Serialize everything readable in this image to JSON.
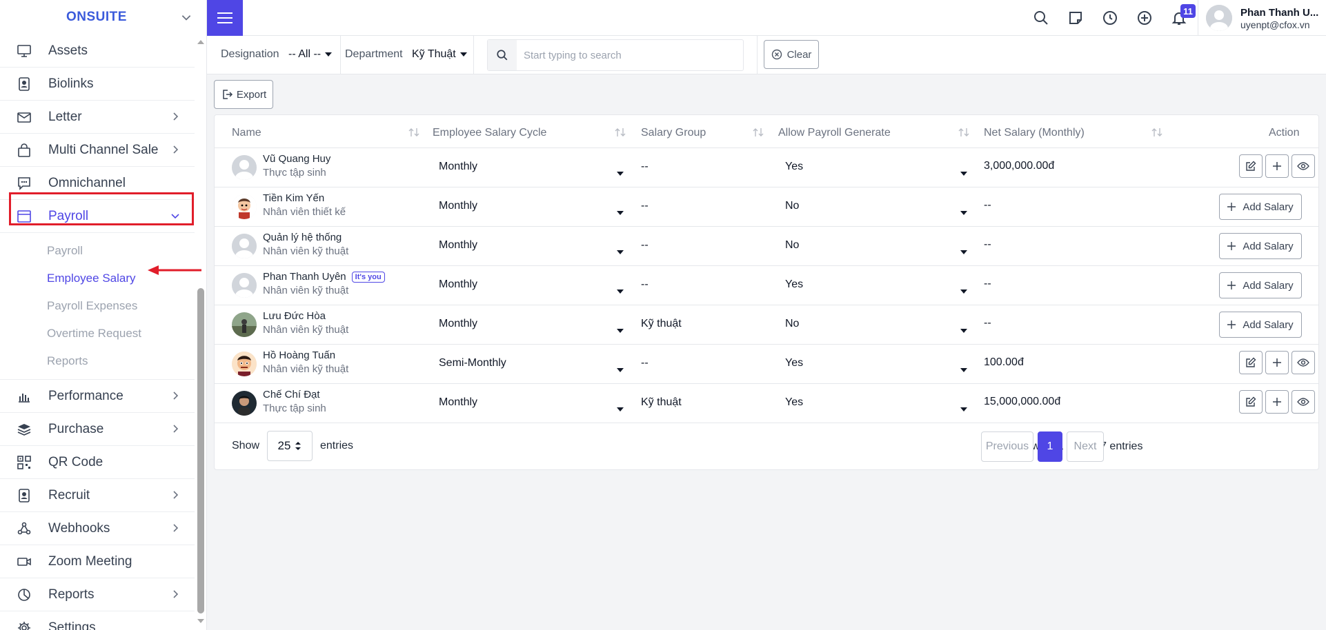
{
  "brand": "ONSUITE",
  "sidebar": {
    "items_top": [
      {
        "label": "Assets",
        "icon": "monitor-icon",
        "chevron": false
      },
      {
        "label": "Biolinks",
        "icon": "badge-icon",
        "chevron": false
      },
      {
        "label": "Letter",
        "icon": "mail-icon",
        "chevron": true
      },
      {
        "label": "Multi Channel Sale",
        "icon": "bag-icon",
        "chevron": true
      },
      {
        "label": "Omnichannel",
        "icon": "chat-icon",
        "chevron": false
      },
      {
        "label": "Payroll",
        "icon": "window-icon",
        "chevron": true
      }
    ],
    "subitems": [
      {
        "label": "Payroll"
      },
      {
        "label": "Employee Salary"
      },
      {
        "label": "Payroll Expenses"
      },
      {
        "label": "Overtime Request"
      },
      {
        "label": "Reports"
      }
    ],
    "items_bottom": [
      {
        "label": "Performance",
        "icon": "bars-icon",
        "chevron": true
      },
      {
        "label": "Purchase",
        "icon": "layers-icon",
        "chevron": true
      },
      {
        "label": "QR Code",
        "icon": "qr-icon",
        "chevron": false
      },
      {
        "label": "Recruit",
        "icon": "badge-icon",
        "chevron": true
      },
      {
        "label": "Webhooks",
        "icon": "webhook-icon",
        "chevron": true
      },
      {
        "label": "Zoom Meeting",
        "icon": "video-icon",
        "chevron": false
      },
      {
        "label": "Reports",
        "icon": "pie-icon",
        "chevron": true
      },
      {
        "label": "Settings",
        "icon": "gear-icon",
        "chevron": false
      }
    ]
  },
  "header": {
    "notification_count": "11",
    "user_name": "Phan Thanh U...",
    "user_email": "uyenpt@cfox.vn"
  },
  "filters": {
    "designation_label": "Designation",
    "designation_value": "-- All --",
    "department_label": "Department",
    "department_value": "Kỹ Thuật",
    "search_placeholder": "Start typing to search",
    "clear_label": "Clear"
  },
  "export_label": "Export",
  "table": {
    "columns": [
      "Name",
      "Employee Salary Cycle",
      "Salary Group",
      "Allow Payroll Generate",
      "Net Salary (Monthly)",
      "Action"
    ],
    "add_salary_label": "Add Salary",
    "you_badge": "It's you",
    "rows": [
      {
        "name": "Vũ Quang Huy",
        "role": "Thực tập sinh",
        "cycle": "Monthly",
        "group": "--",
        "allow": "Yes",
        "net": "3,000,000.00đ",
        "avatar": "default",
        "has_salary": true,
        "you": false
      },
      {
        "name": "Tiền Kim Yến",
        "role": "Nhân viên thiết kế",
        "cycle": "Monthly",
        "group": "--",
        "allow": "No",
        "net": "--",
        "avatar": "cartoon",
        "has_salary": false,
        "you": false
      },
      {
        "name": "Quản lý hệ thống",
        "role": "Nhân viên kỹ thuật",
        "cycle": "Monthly",
        "group": "--",
        "allow": "No",
        "net": "--",
        "avatar": "default",
        "has_salary": false,
        "you": false
      },
      {
        "name": "Phan Thanh Uyên",
        "role": "Nhân viên kỹ thuật",
        "cycle": "Monthly",
        "group": "--",
        "allow": "Yes",
        "net": "--",
        "avatar": "default",
        "has_salary": false,
        "you": true
      },
      {
        "name": "Lưu Đức Hòa",
        "role": "Nhân viên kỹ thuật",
        "cycle": "Monthly",
        "group": "Kỹ thuật",
        "allow": "No",
        "net": "--",
        "avatar": "photo",
        "has_salary": false,
        "you": false
      },
      {
        "name": "Hồ Hoàng Tuấn",
        "role": "Nhân viên kỹ thuật",
        "cycle": "Semi-Monthly",
        "group": "--",
        "allow": "Yes",
        "net": "100.00đ",
        "avatar": "cartoon2",
        "has_salary": true,
        "you": false
      },
      {
        "name": "Chế Chí Đạt",
        "role": "Thực tập sinh",
        "cycle": "Monthly",
        "group": "Kỹ thuật",
        "allow": "Yes",
        "net": "15,000,000.00đ",
        "avatar": "photo2",
        "has_salary": true,
        "you": false
      }
    ]
  },
  "pagination": {
    "show_label": "Show",
    "page_size": "25",
    "entries_label": "entries",
    "showing_text": "Showing 1 to 7 of 7 entries",
    "previous_label": "Previous",
    "current_page": "1",
    "next_label": "Next"
  },
  "colors": {
    "accent": "#4f46e5",
    "highlight_red": "#e11d2a"
  }
}
